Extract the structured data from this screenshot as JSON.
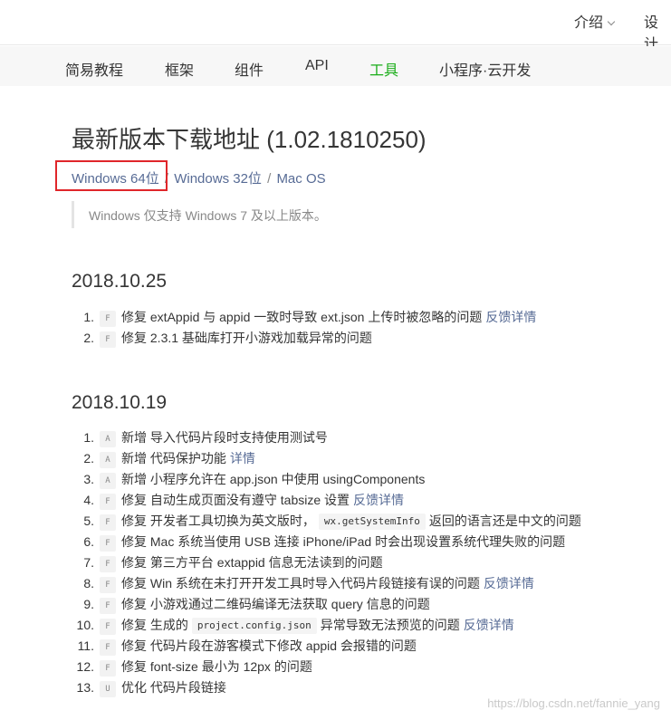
{
  "topbar": {
    "intro_label": "介绍",
    "design_label": "设计"
  },
  "subnav": {
    "items": [
      {
        "label": "简易教程"
      },
      {
        "label": "框架"
      },
      {
        "label": "组件"
      },
      {
        "label": "API"
      },
      {
        "label": "工具"
      },
      {
        "label": "小程序·云开发"
      }
    ],
    "active_index": 4
  },
  "page": {
    "title": "最新版本下载地址 (1.02.1810250)",
    "downloads": {
      "win64": "Windows 64位",
      "win32": "Windows 32位",
      "mac": "Mac OS",
      "separator": "/"
    },
    "note": "Windows 仅支持 Windows 7 及以上版本。"
  },
  "releases": [
    {
      "date": "2018.10.25",
      "items": [
        {
          "num": "1.",
          "tag": "F",
          "text": "修复 extAppid 与 appid 一致时导致 ext.json 上传时被忽略的问题",
          "link": "反馈详情"
        },
        {
          "num": "2.",
          "tag": "F",
          "text": "修复 2.3.1 基础库打开小游戏加载异常的问题"
        }
      ]
    },
    {
      "date": "2018.10.19",
      "items": [
        {
          "num": "1.",
          "tag": "A",
          "text": "新增 导入代码片段时支持使用测试号"
        },
        {
          "num": "2.",
          "tag": "A",
          "text": "新增 代码保护功能",
          "link": "详情"
        },
        {
          "num": "3.",
          "tag": "A",
          "text": "新增 小程序允许在 app.json 中使用 usingComponents"
        },
        {
          "num": "4.",
          "tag": "F",
          "text": "修复 自动生成页面没有遵守 tabsize 设置",
          "link": "反馈详情"
        },
        {
          "num": "5.",
          "tag": "F",
          "text": "修复 开发者工具切换为英文版时，",
          "code": "wx.getSystemInfo",
          "text_after": "返回的语言还是中文的问题"
        },
        {
          "num": "6.",
          "tag": "F",
          "text": "修复 Mac 系统当使用 USB 连接 iPhone/iPad 时会出现设置系统代理失败的问题"
        },
        {
          "num": "7.",
          "tag": "F",
          "text": "修复 第三方平台 extappid 信息无法读到的问题"
        },
        {
          "num": "8.",
          "tag": "F",
          "text": "修复 Win 系统在未打开开发工具时导入代码片段链接有误的问题",
          "link": "反馈详情"
        },
        {
          "num": "9.",
          "tag": "F",
          "text": "修复 小游戏通过二维码编译无法获取 query 信息的问题"
        },
        {
          "num": "10.",
          "tag": "F",
          "text": "修复 生成的",
          "code": "project.config.json",
          "text_after": "异常导致无法预览的问题",
          "link": "反馈详情"
        },
        {
          "num": "11.",
          "tag": "F",
          "text": "修复 代码片段在游客模式下修改 appid 会报错的问题"
        },
        {
          "num": "12.",
          "tag": "F",
          "text": "修复 font-size 最小为 12px 的问题"
        },
        {
          "num": "13.",
          "tag": "U",
          "text": "优化 代码片段链接"
        }
      ]
    }
  ],
  "watermark": "https://blog.csdn.net/fannie_yang"
}
